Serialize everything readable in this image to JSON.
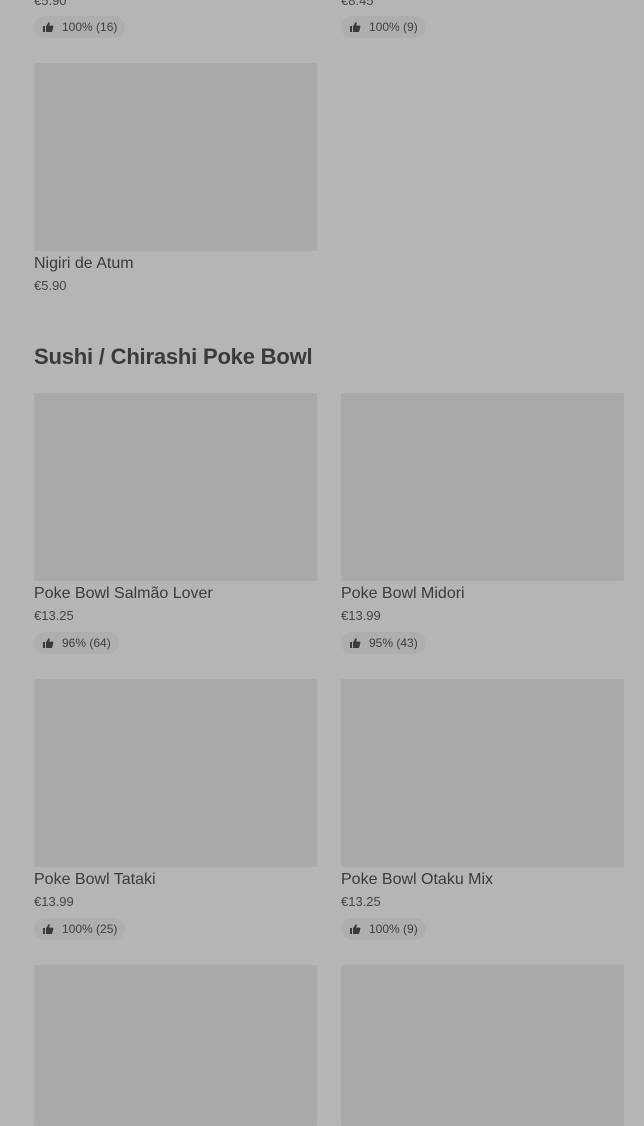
{
  "top_partial": [
    {
      "price": "€5.90",
      "rating": "100% (16)"
    },
    {
      "price": "€8.45",
      "rating": "100% (9)"
    }
  ],
  "prev_section": {
    "items": [
      {
        "name": "Nigiri de Atum",
        "price": "€5.90"
      }
    ]
  },
  "section": {
    "title": "Sushi / Chirashi Poke Bowl",
    "items": [
      {
        "name": "Poke Bowl Salmão Lover",
        "price": "€13.25",
        "rating": "96% (64)"
      },
      {
        "name": "Poke Bowl Midori",
        "price": "€13.99",
        "rating": "95% (43)"
      },
      {
        "name": "Poke Bowl Tataki",
        "price": "€13.99",
        "rating": "100% (25)"
      },
      {
        "name": "Poke Bowl Otaku Mix",
        "price": "€13.25",
        "rating": "100% (9)"
      }
    ]
  },
  "icons": {
    "rating": "thumbs-up-icon"
  }
}
